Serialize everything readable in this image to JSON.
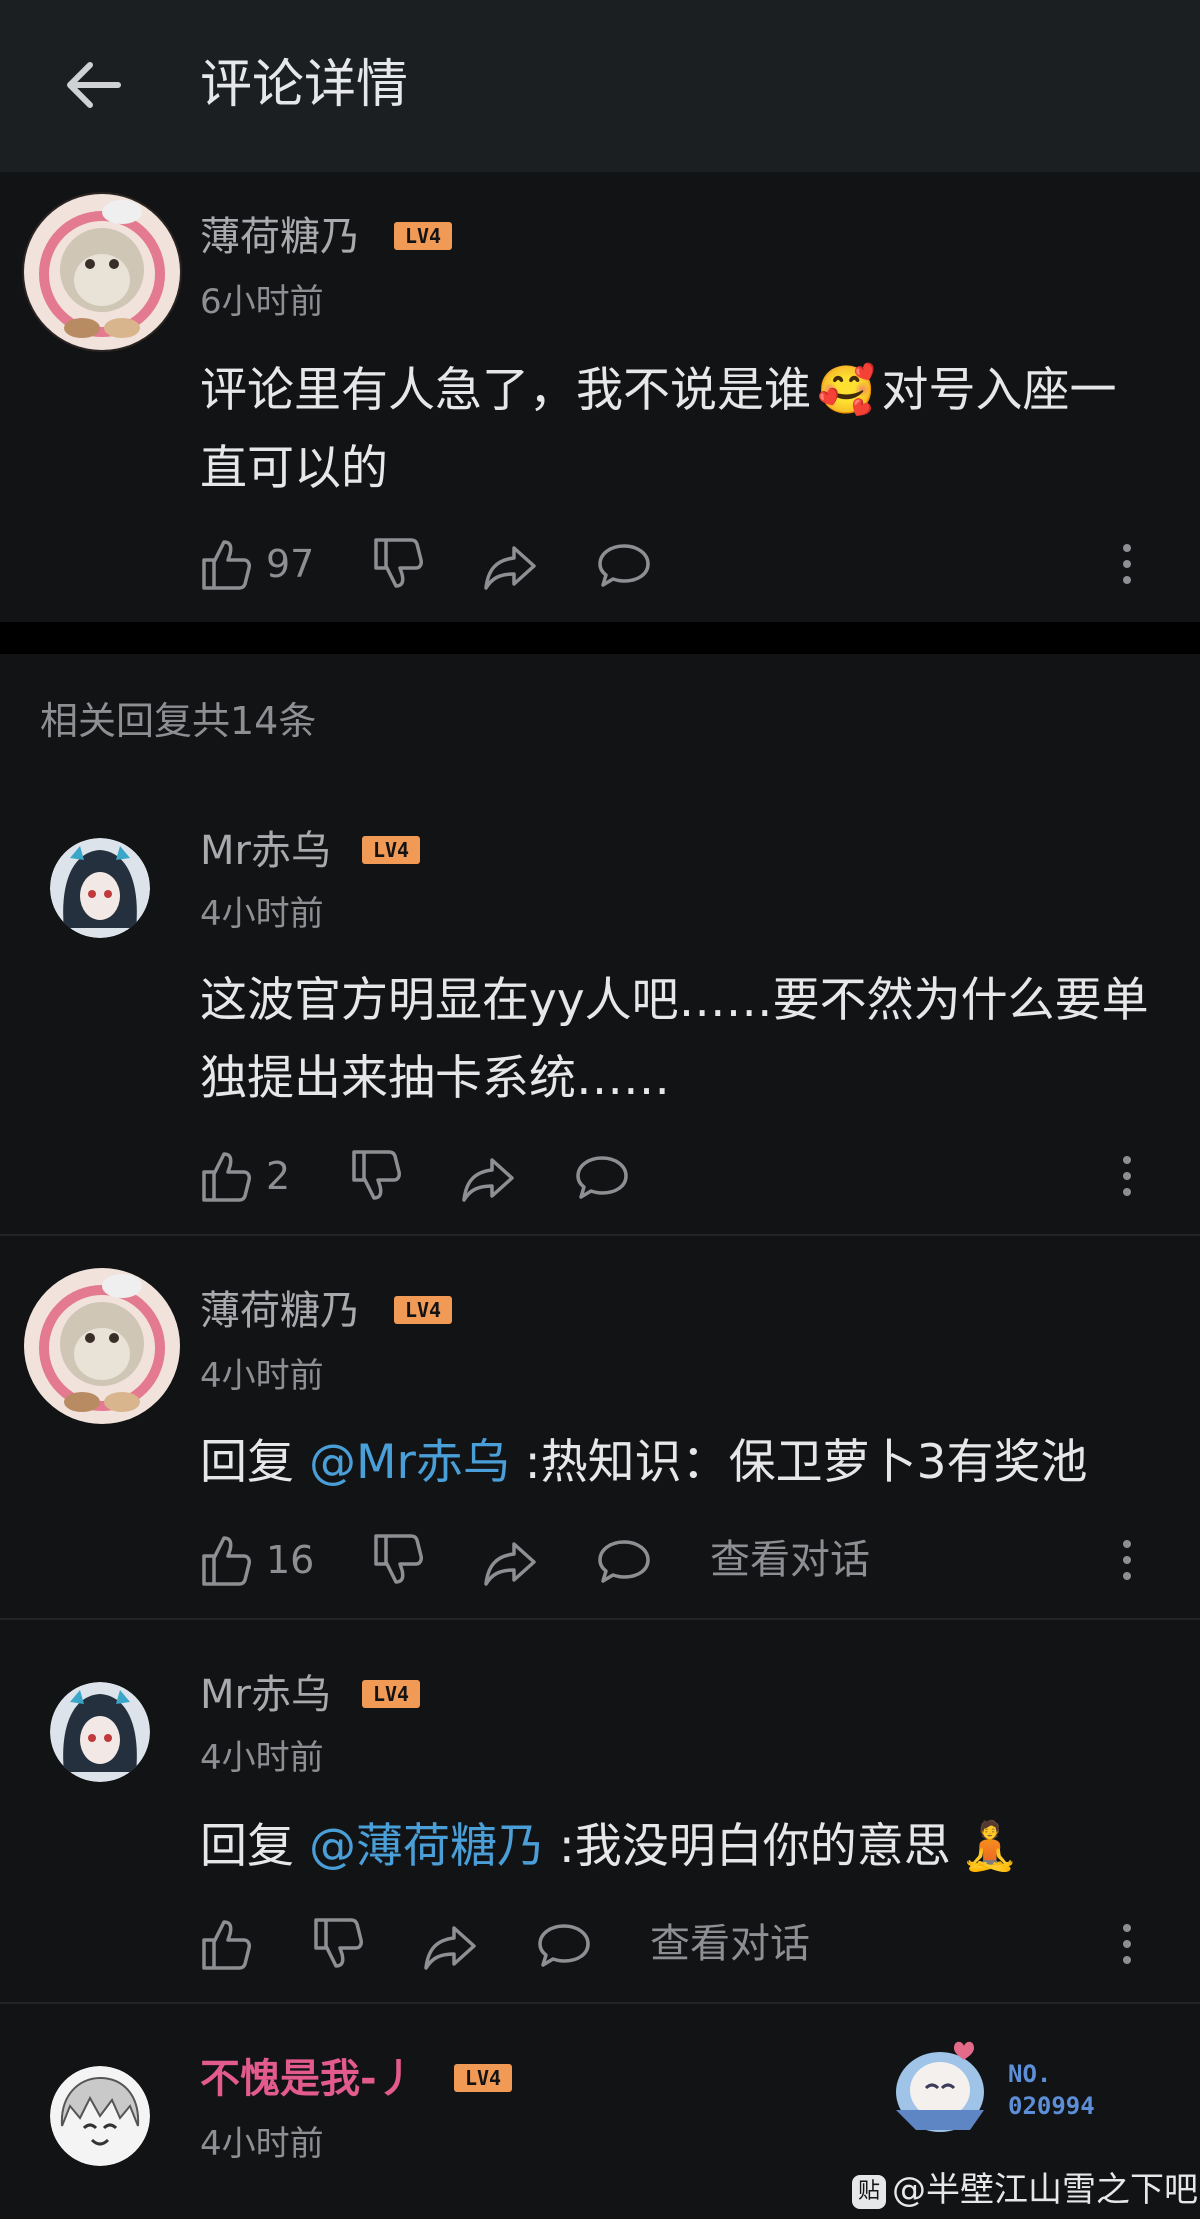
{
  "header": {
    "title": "评论详情"
  },
  "main_comment": {
    "user": "薄荷糖乃",
    "level": "LV4",
    "time": "6小时前",
    "text": "评论里有人急了，我不说是谁",
    "emoji": "🥰",
    "text_after": "对号入座一直可以的",
    "likes": "97"
  },
  "replies_count_label": "相关回复共14条",
  "replies": [
    {
      "user": "Mr赤乌",
      "level": "LV4",
      "time": "4小时前",
      "text": "这波官方明显在yy人吧……要不然为什么要单独提出来抽卡系统……",
      "likes": "2"
    },
    {
      "user": "薄荷糖乃",
      "level": "LV4",
      "time": "4小时前",
      "reply_prefix": "回复 ",
      "mention": "@Mr赤乌",
      "text": " :热知识：保卫萝卜3有奖池",
      "likes": "16",
      "view_conversation": "查看对话"
    },
    {
      "user": "Mr赤乌",
      "level": "LV4",
      "time": "4小时前",
      "reply_prefix": "回复 ",
      "mention": "@薄荷糖乃",
      "text": " :我没明白你的意思",
      "emoji": "🧘",
      "likes": "",
      "view_conversation": "查看对话"
    },
    {
      "user": "不愧是我-丿",
      "level": "LV4",
      "time": "4小时前"
    }
  ],
  "badge": {
    "line1": "NO.",
    "line2": "020994"
  },
  "watermark": {
    "logo": "贴",
    "text": "@半壁江山雪之下吧"
  },
  "colors": {
    "background": "#121314",
    "header": "#1c1f22",
    "mention": "#4a9fd8",
    "level_badge": "#f19a55",
    "highlight_name": "#e25b8c"
  }
}
